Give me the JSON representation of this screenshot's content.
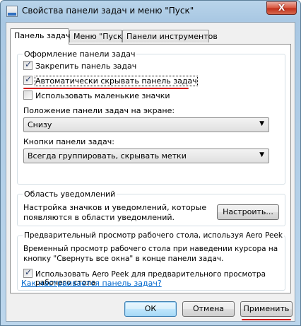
{
  "window": {
    "title": "Свойства панели задач и меню \"Пуск\"",
    "close_glyph": "X"
  },
  "tabs": [
    {
      "label": "Панель задач",
      "active": true
    },
    {
      "label": "Меню \"Пуск\"",
      "active": false
    },
    {
      "label": "Панели инструментов",
      "active": false
    }
  ],
  "appearance": {
    "title": "Оформление панели задач",
    "lock_label": "Закрепить панель задач",
    "lock_checked": true,
    "autohide_label": "Автоматически скрывать панель задач",
    "autohide_checked": true,
    "small_icons_label": "Использовать маленькие значки",
    "small_icons_checked": false,
    "position_label": "Положение панели задач на экране:",
    "position_value": "Снизу",
    "buttons_label": "Кнопки панели задач:",
    "buttons_value": "Всегда группировать, скрывать метки"
  },
  "notifications": {
    "title": "Область уведомлений",
    "description_line1": "Настройка значков и уведомлений, которые",
    "description_line2": "появляются в области уведомлений.",
    "customize_label": "Настроить..."
  },
  "aero_peek": {
    "title": "Предварительный просмотр рабочего стола, используя Aero Peek",
    "description_line1": "Временный просмотр рабочего стола при наведении курсора на",
    "description_line2": "кнопку \"Свернуть все окна\" в конце панели задач.",
    "checkbox_line1": "Использовать Aero Peek для предварительного просмотра",
    "checkbox_line2": "рабочего стола",
    "checked": true
  },
  "help_link": "Как настраивается панель задач?",
  "footer": {
    "ok_label": "ОК",
    "cancel_label": "Отмена",
    "apply_label": "Применить"
  },
  "colors": {
    "highlight_marker": "#d11818",
    "link": "#0066cc"
  }
}
